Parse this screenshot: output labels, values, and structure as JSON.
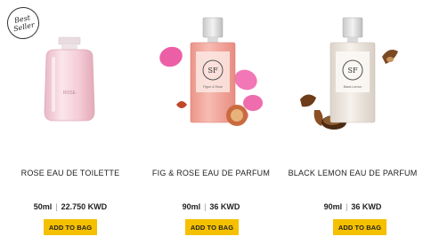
{
  "badge": {
    "line1": "Best",
    "line2": "Seller"
  },
  "products": [
    {
      "name": "ROSE EAU DE TOILETTE",
      "size": "50ml",
      "price": "22.750 KWD",
      "button": "ADD TO BAG",
      "bottle_label": "ROSE"
    },
    {
      "name": "FIG & ROSE EAU DE PARFUM",
      "size": "90ml",
      "price": "36 KWD",
      "button": "ADD TO BAG",
      "bottle_label": "Figue & Rose"
    },
    {
      "name": "BLACK LEMON EAU DE PARFUM",
      "size": "90ml",
      "price": "36 KWD",
      "button": "ADD TO BAG",
      "bottle_label": "Black Lemon"
    }
  ],
  "colors": {
    "button": "#f5c000",
    "text": "#222222",
    "rose_bottle": "#f6d3dc",
    "fig_bottle": "#f2a9a0",
    "lemon_bottle": "#efe9e2"
  }
}
